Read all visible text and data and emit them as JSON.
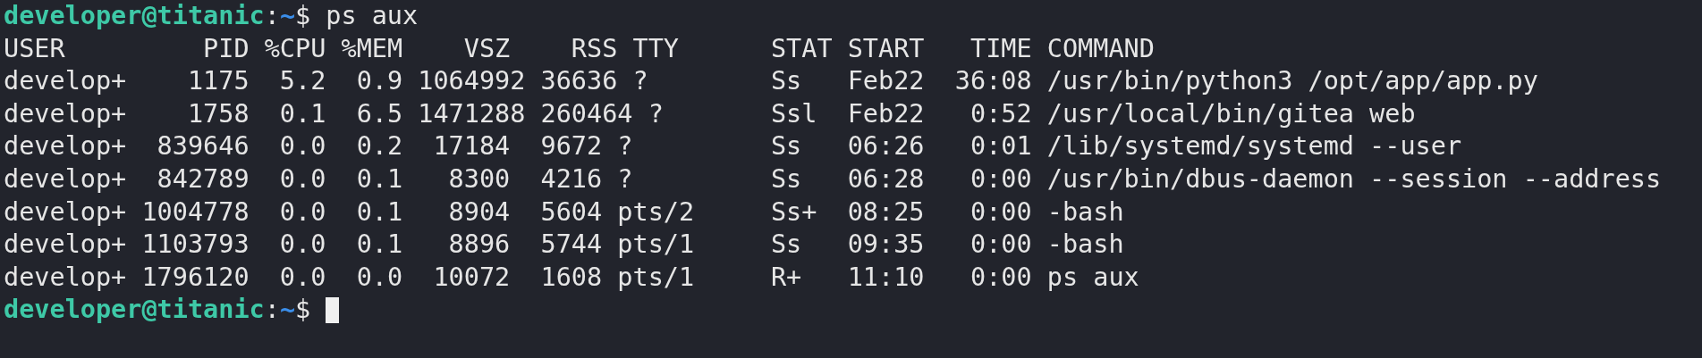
{
  "terminal": {
    "lines": [
      {
        "kind": "prompt",
        "user_host": "developer@titanic",
        "separator": ":",
        "path": "~",
        "symbol": "$",
        "command": "ps aux",
        "cursor": false
      },
      {
        "kind": "header",
        "text": "USER         PID %CPU %MEM    VSZ    RSS TTY      STAT START   TIME COMMAND"
      },
      {
        "kind": "output",
        "text": "develop+    1175  5.2  0.9 1064992 36636 ?        Ss   Feb22  36:08 /usr/bin/python3 /opt/app/app.py"
      },
      {
        "kind": "output",
        "text": "develop+    1758  0.1  6.5 1471288 260464 ?       Ssl  Feb22   0:52 /usr/local/bin/gitea web"
      },
      {
        "kind": "output",
        "text": "develop+  839646  0.0  0.2  17184  9672 ?         Ss   06:26   0:01 /lib/systemd/systemd --user"
      },
      {
        "kind": "output",
        "text": "develop+  842789  0.0  0.1   8300  4216 ?         Ss   06:28   0:00 /usr/bin/dbus-daemon --session --address"
      },
      {
        "kind": "output",
        "text": "develop+ 1004778  0.0  0.1   8904  5604 pts/2     Ss+  08:25   0:00 -bash"
      },
      {
        "kind": "output",
        "text": "develop+ 1103793  0.0  0.1   8896  5744 pts/1     Ss   09:35   0:00 -bash"
      },
      {
        "kind": "output",
        "text": "develop+ 1796120  0.0  0.0  10072  1608 pts/1     R+   11:10   0:00 ps aux"
      },
      {
        "kind": "prompt",
        "user_host": "developer@titanic",
        "separator": ":",
        "path": "~",
        "symbol": "$",
        "cursor": true
      }
    ]
  }
}
